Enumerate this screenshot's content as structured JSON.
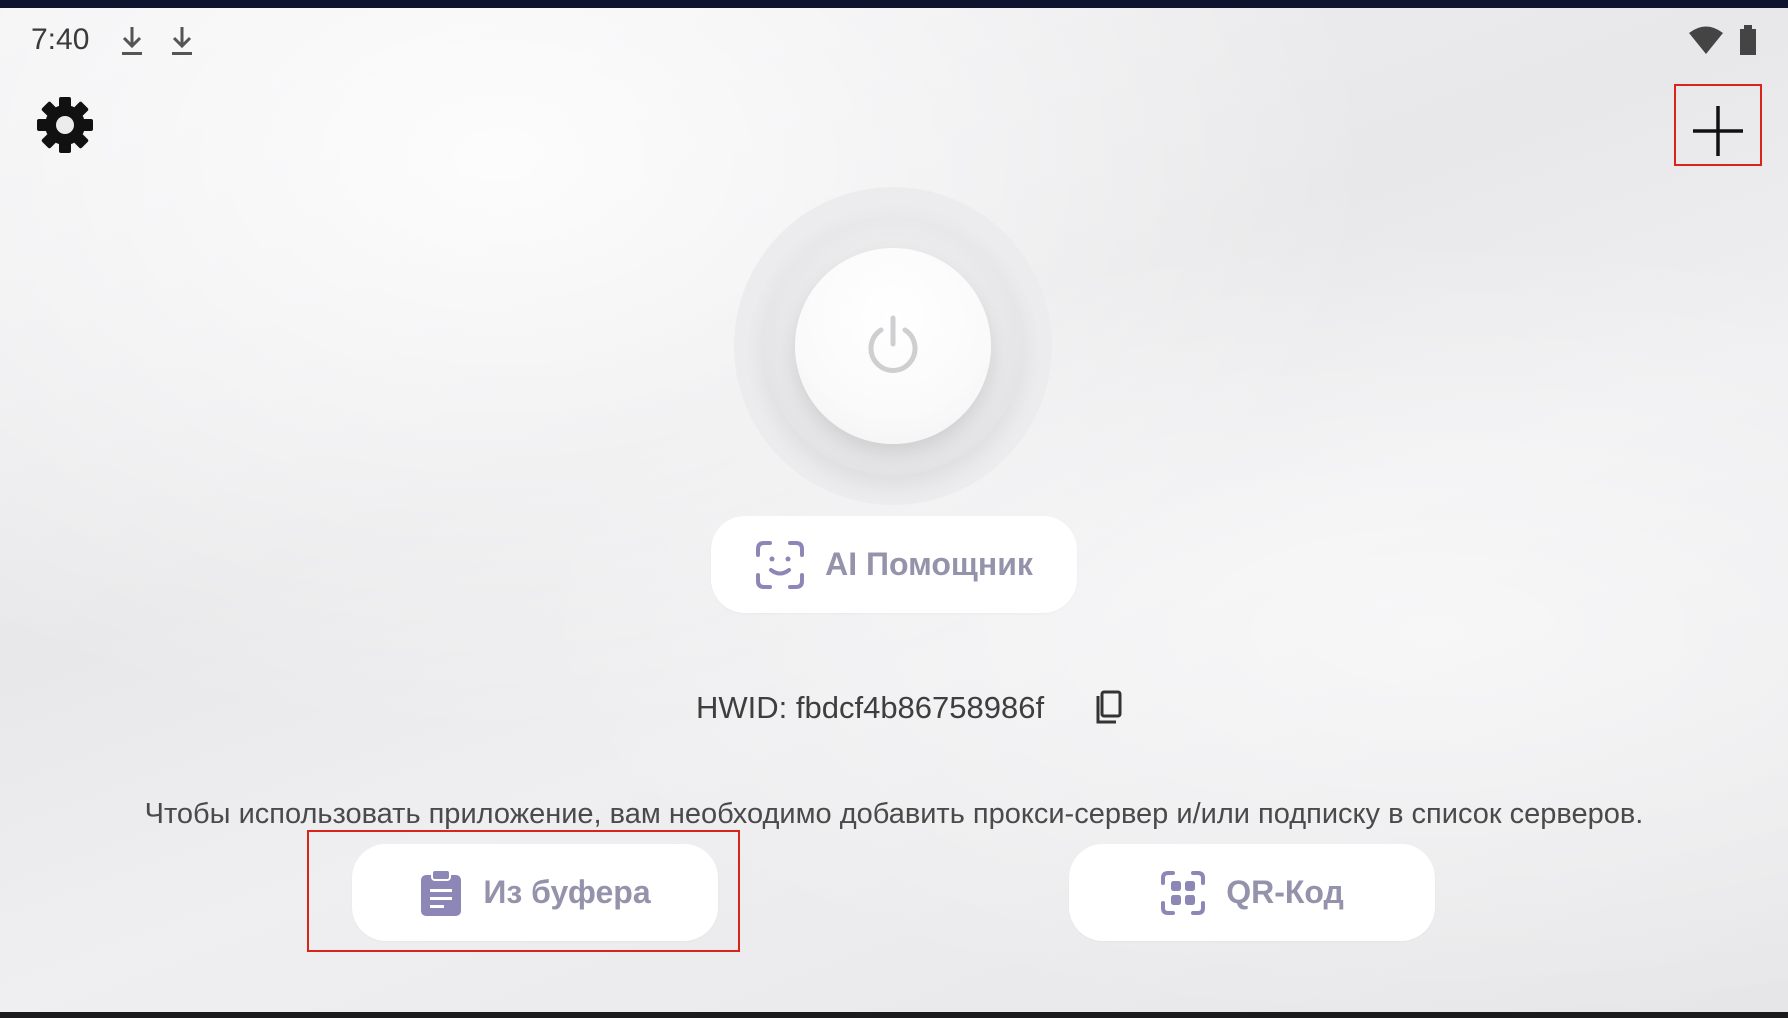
{
  "status_bar": {
    "time": "7:40",
    "left_icons": [
      "download-icon",
      "download-icon"
    ],
    "right_icons": [
      "wifi-icon",
      "battery-icon"
    ]
  },
  "toolbar": {
    "settings_icon": "gear-icon",
    "add_icon": "plus-icon"
  },
  "connect": {
    "icon": "power-icon"
  },
  "ai_button": {
    "label": "AI Помощник",
    "icon": "face-scan-icon"
  },
  "hwid": {
    "text": "HWID: fbdcf4b86758986f",
    "copy_icon": "copy-icon"
  },
  "info_text": "Чтобы использовать приложение, вам необходимо добавить прокси-сервер и/или подписку в список серверов.",
  "actions": {
    "clipboard": {
      "label": "Из буфера",
      "icon": "clipboard-icon"
    },
    "qr": {
      "label": "QR-Код",
      "icon": "qr-scan-icon"
    }
  },
  "colors": {
    "accent": "#9593ab",
    "icon_accent": "#8d87b8",
    "highlight": "#d9231b"
  }
}
